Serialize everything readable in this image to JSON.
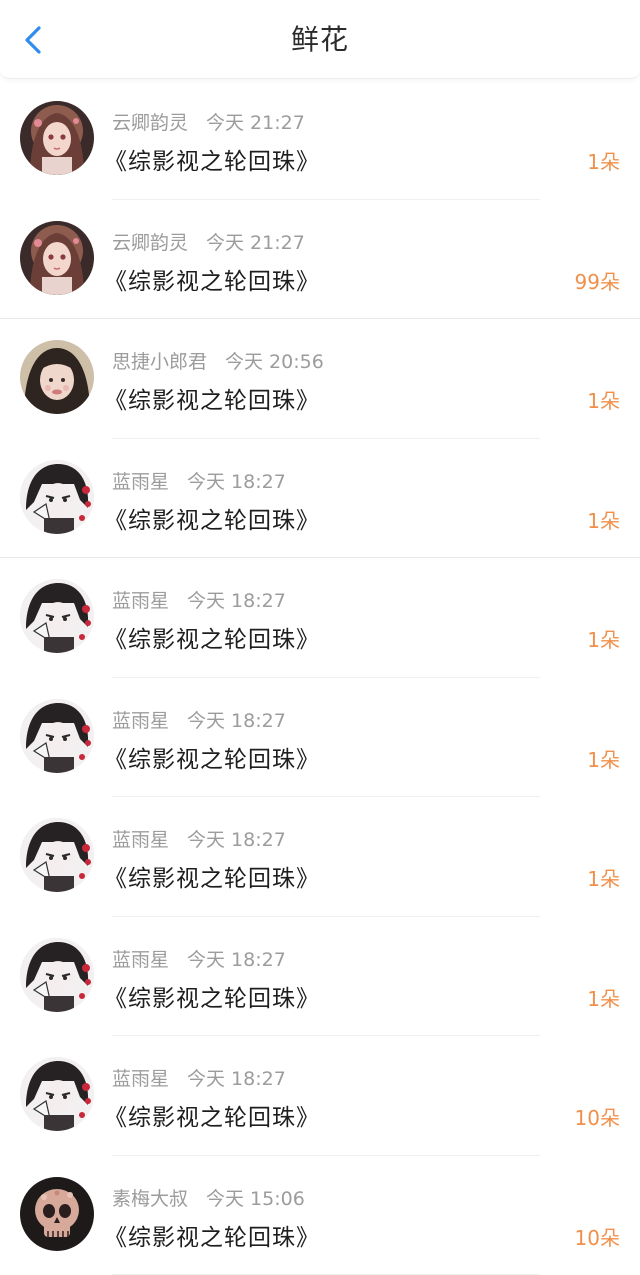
{
  "header": {
    "title": "鲜花",
    "back_icon": "chevron-left-icon",
    "accent_color": "#2d8cf0"
  },
  "count_color": "#f0904a",
  "items": [
    {
      "user": "云卿韵灵",
      "time": "今天 21:27",
      "book": "《综影视之轮回珠》",
      "count": "1朵",
      "avatar": "anime-girl-pink"
    },
    {
      "user": "云卿韵灵",
      "time": "今天 21:27",
      "book": "《综影视之轮回珠》",
      "count": "99朵",
      "avatar": "anime-girl-pink"
    },
    {
      "user": "思捷小郎君",
      "time": "今天 20:56",
      "book": "《综影视之轮回珠》",
      "count": "1朵",
      "avatar": "girl-photo"
    },
    {
      "user": "蓝雨星",
      "time": "今天 18:27",
      "book": "《综影视之轮回珠》",
      "count": "1朵",
      "avatar": "anime-boy-dark"
    },
    {
      "user": "蓝雨星",
      "time": "今天 18:27",
      "book": "《综影视之轮回珠》",
      "count": "1朵",
      "avatar": "anime-boy-dark"
    },
    {
      "user": "蓝雨星",
      "time": "今天 18:27",
      "book": "《综影视之轮回珠》",
      "count": "1朵",
      "avatar": "anime-boy-dark"
    },
    {
      "user": "蓝雨星",
      "time": "今天 18:27",
      "book": "《综影视之轮回珠》",
      "count": "1朵",
      "avatar": "anime-boy-dark"
    },
    {
      "user": "蓝雨星",
      "time": "今天 18:27",
      "book": "《综影视之轮回珠》",
      "count": "1朵",
      "avatar": "anime-boy-dark"
    },
    {
      "user": "蓝雨星",
      "time": "今天 18:27",
      "book": "《综影视之轮回珠》",
      "count": "10朵",
      "avatar": "anime-boy-dark"
    },
    {
      "user": "素梅大叔",
      "time": "今天 15:06",
      "book": "《综影视之轮回珠》",
      "count": "10朵",
      "avatar": "floral-skull"
    }
  ]
}
